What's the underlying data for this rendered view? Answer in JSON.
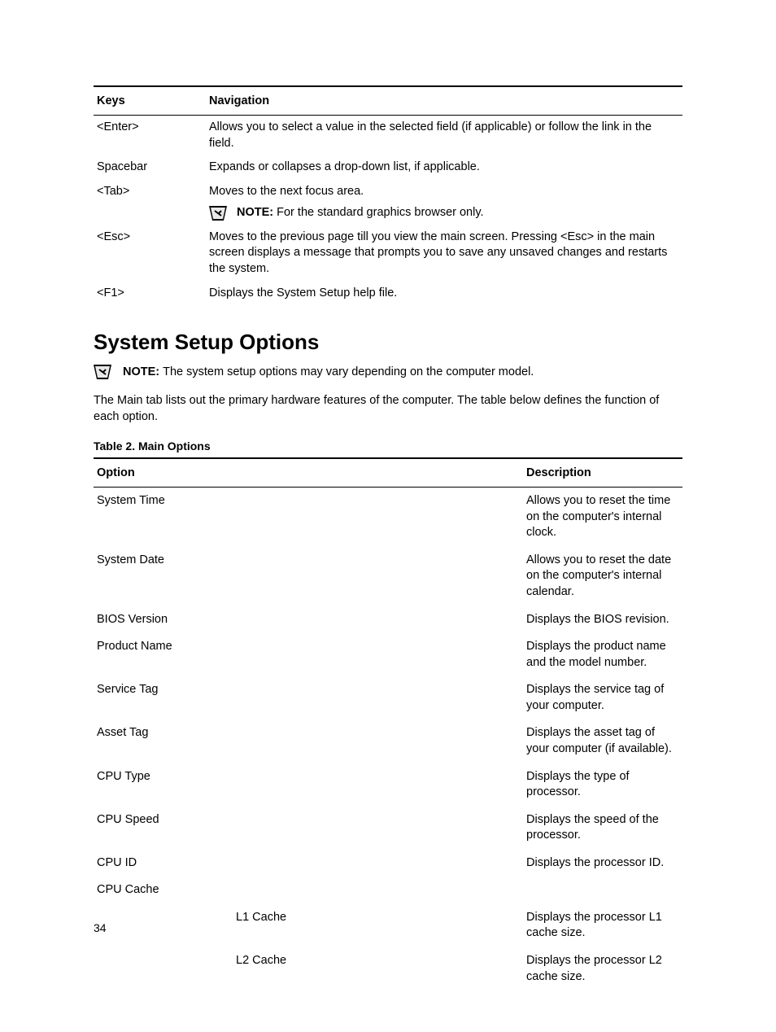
{
  "keys_table": {
    "head": {
      "keys": "Keys",
      "nav": "Navigation"
    },
    "rows": {
      "enter": {
        "key": "<Enter>",
        "nav": "Allows you to select a value in the selected field (if applicable) or follow the link in the field."
      },
      "spacebar": {
        "key": "Spacebar",
        "nav": "Expands or collapses a drop-down list, if applicable."
      },
      "tab": {
        "key": "<Tab>",
        "nav": "Moves to the next focus area."
      },
      "tab_note": {
        "label": "NOTE: ",
        "text": "For the standard graphics browser only."
      },
      "esc": {
        "key": "<Esc>",
        "nav": "Moves to the previous page till you view the main screen. Pressing <Esc> in the main screen displays a message that prompts you to save any unsaved changes and restarts the system."
      },
      "f1": {
        "key": "<F1>",
        "nav": "Displays the System Setup help file."
      }
    }
  },
  "heading": "System Setup Options",
  "heading_note": {
    "label": "NOTE: ",
    "text": "The system setup options may vary depending on the computer model."
  },
  "intro_para": "The Main tab lists out the primary hardware features of the computer. The table below defines the function of each option.",
  "table2": {
    "caption": "Table 2. Main Options",
    "head": {
      "option": "Option",
      "desc": "Description"
    },
    "rows": {
      "system_time": {
        "opt": "System Time",
        "desc": "Allows you to reset the time on the computer's internal clock."
      },
      "system_date": {
        "opt": "System Date",
        "desc": "Allows you to reset the date on the computer's internal calendar."
      },
      "bios_version": {
        "opt": "BIOS Version",
        "desc": "Displays the BIOS revision."
      },
      "product_name": {
        "opt": "Product Name",
        "desc": "Displays the product name and the model number."
      },
      "service_tag": {
        "opt": "Service Tag",
        "desc": "Displays the service tag of your computer."
      },
      "asset_tag": {
        "opt": "Asset Tag",
        "desc": "Displays the asset tag of your computer (if available)."
      },
      "cpu_type": {
        "opt": "CPU Type",
        "desc": "Displays the type of processor."
      },
      "cpu_speed": {
        "opt": "CPU Speed",
        "desc": "Displays the speed of the processor."
      },
      "cpu_id": {
        "opt": "CPU ID",
        "desc": "Displays the processor ID."
      },
      "cpu_cache": {
        "opt": "CPU Cache",
        "desc": ""
      },
      "l1": {
        "opt": "L1 Cache",
        "desc": "Displays the processor L1 cache size."
      },
      "l2": {
        "opt": "L2 Cache",
        "desc": "Displays the processor L2 cache size."
      }
    }
  },
  "page_number": "34"
}
